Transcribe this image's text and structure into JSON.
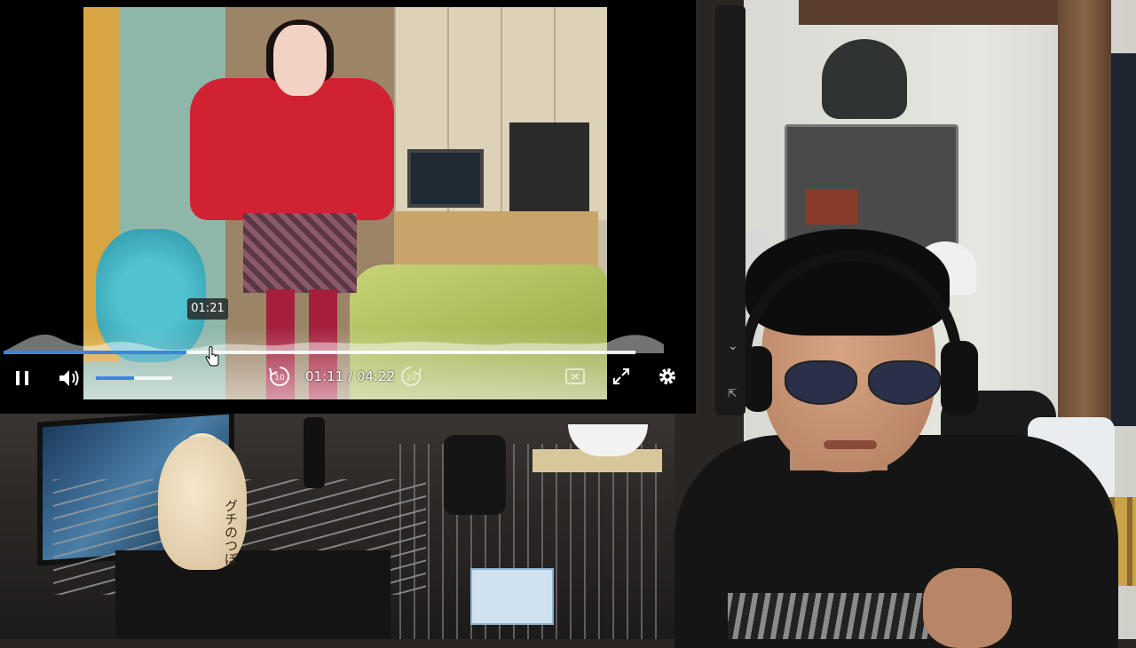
{
  "player": {
    "hover_time": "01:21",
    "time_display": "01:11 / 04:22",
    "progress_fraction": 0.29,
    "buffer_fraction": 1.0,
    "volume_fraction": 0.5,
    "accent_color": "#3a86e0",
    "icons": {
      "play_pause": "pause-icon",
      "volume": "volume-icon",
      "rewind": "rewind-10-icon",
      "forward": "forward-10-icon",
      "pip": "picture-in-picture-icon",
      "fullscreen": "fullscreen-icon",
      "settings": "gear-icon"
    }
  },
  "scene": {
    "jar_label": "グチのつぼ"
  }
}
